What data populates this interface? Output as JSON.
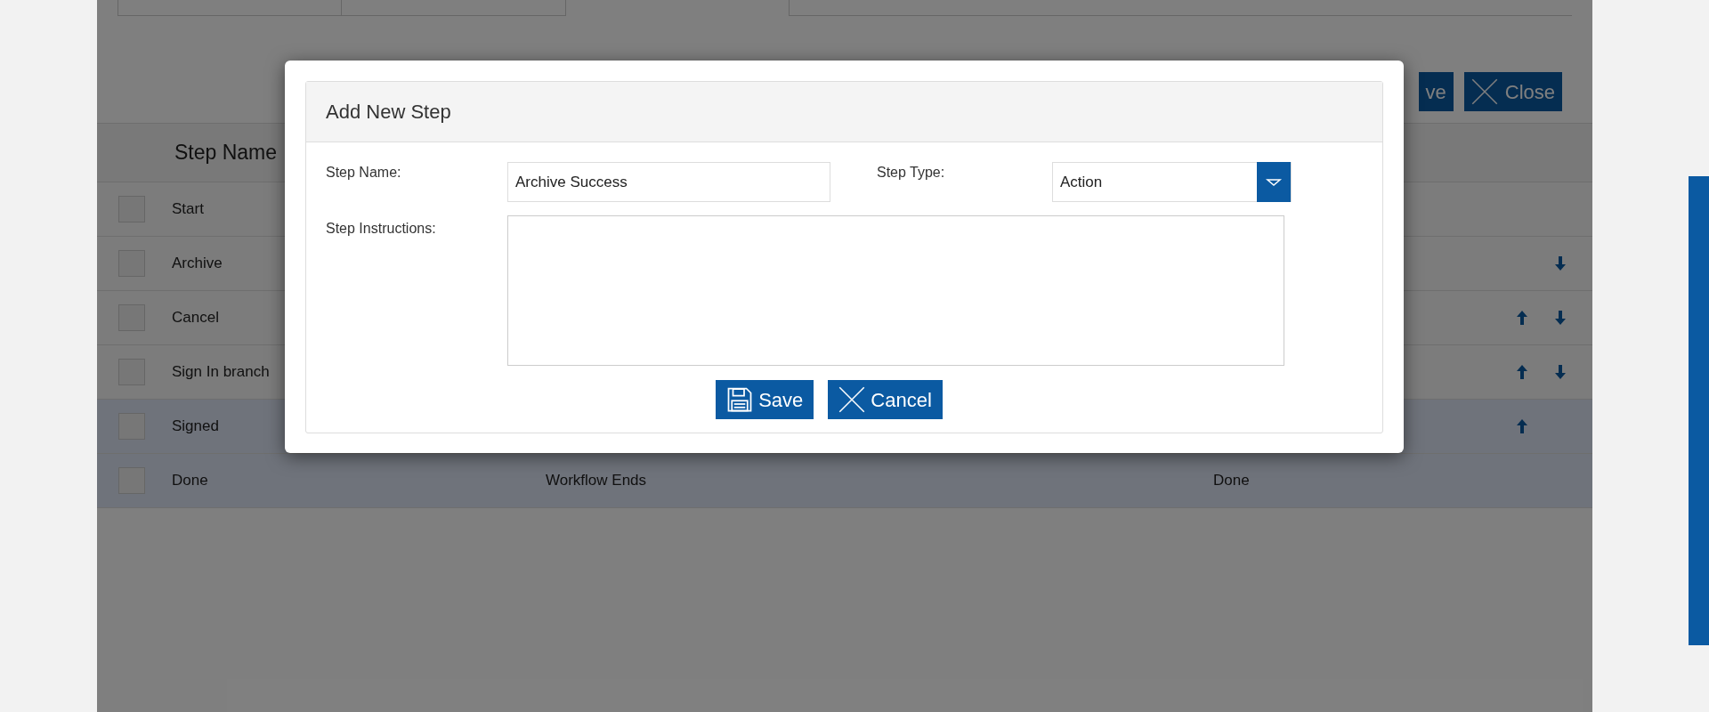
{
  "background": {
    "toolbar": [
      {
        "kind": "save",
        "label": "ve"
      },
      {
        "kind": "close",
        "label": "Close"
      }
    ],
    "table": {
      "columns": [
        "Step Name"
      ],
      "rows": [
        {
          "name": "Start",
          "move_up": false,
          "move_down": false,
          "selected": false
        },
        {
          "name": "Archive",
          "move_up": false,
          "move_down": true,
          "selected": false
        },
        {
          "name": "Cancel",
          "move_up": true,
          "move_down": true,
          "selected": false
        },
        {
          "name": "Sign In branch",
          "move_up": true,
          "move_down": true,
          "selected": false
        },
        {
          "name": "Signed",
          "move_up": true,
          "move_down": false,
          "selected": true
        },
        {
          "name": "Done",
          "column_2": "Workflow Ends",
          "column_3": "Done",
          "move_up": false,
          "move_down": false,
          "selected": true
        }
      ]
    }
  },
  "dialog": {
    "title": "Add New Step",
    "step_name": {
      "label": "Step Name:",
      "value": "Archive Success"
    },
    "step_type": {
      "label": "Step Type:",
      "value": "Action"
    },
    "step_instructions": {
      "label": "Step Instructions:"
    },
    "buttons": [
      {
        "kind": "save",
        "label": "Save"
      },
      {
        "kind": "cancel",
        "label": "Cancel"
      }
    ]
  }
}
